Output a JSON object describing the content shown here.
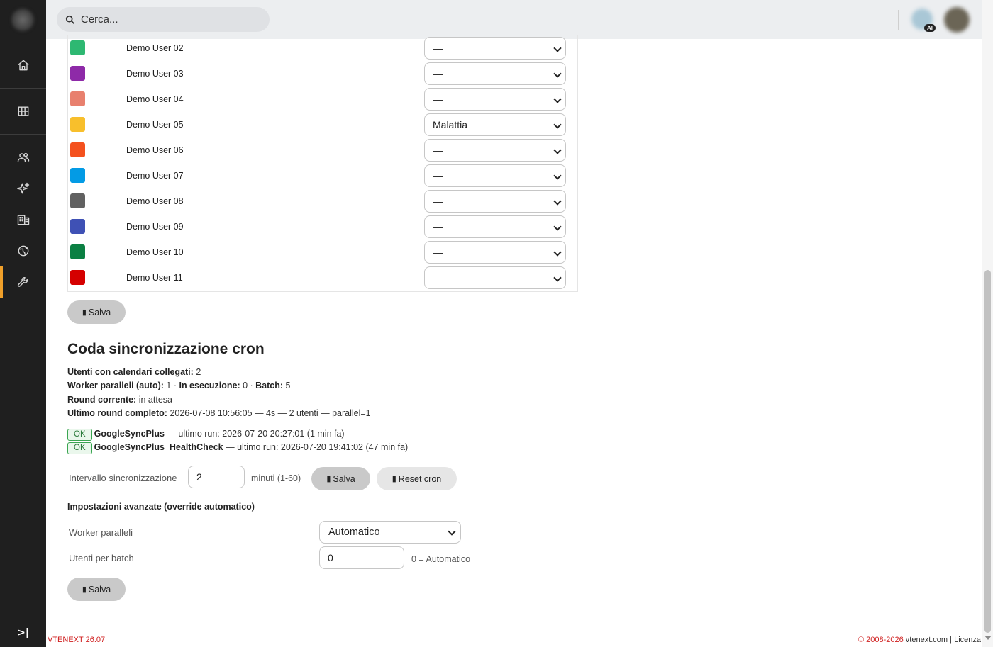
{
  "search": {
    "placeholder": "Cerca..."
  },
  "ai_badge": "AI",
  "users": [
    {
      "name": "Demo User 02",
      "color": "#2eb872",
      "absence": "—"
    },
    {
      "name": "Demo User 03",
      "color": "#8e2aa8",
      "absence": "—"
    },
    {
      "name": "Demo User 04",
      "color": "#e8806e",
      "absence": "—"
    },
    {
      "name": "Demo User 05",
      "color": "#f8bf2c",
      "absence": "Malattia"
    },
    {
      "name": "Demo User 06",
      "color": "#f4511e",
      "absence": "—"
    },
    {
      "name": "Demo User 07",
      "color": "#039be5",
      "absence": "—"
    },
    {
      "name": "Demo User 08",
      "color": "#616161",
      "absence": "—"
    },
    {
      "name": "Demo User 09",
      "color": "#3f51b5",
      "absence": "—"
    },
    {
      "name": "Demo User 10",
      "color": "#0b8043",
      "absence": "—"
    },
    {
      "name": "Demo User 11",
      "color": "#d50000",
      "absence": "—"
    }
  ],
  "save_label": "Salva",
  "save_icon": "▮",
  "cron": {
    "title": "Coda sincronizzazione cron",
    "linked_label": "Utenti con calendari collegati:",
    "linked_value": "2",
    "workers_label": "Worker paralleli (auto):",
    "workers_value": "1",
    "running_label": "In esecuzione:",
    "running_value": "0",
    "batch_label": "Batch:",
    "batch_value": "5",
    "round_label": "Round corrente:",
    "round_value": "in attesa",
    "last_label": "Ultimo round completo:",
    "last_value": "2026-07-08 10:56:05 — 4s — 2 utenti — parallel=1",
    "jobs": [
      {
        "status": "OK",
        "name": "GoogleSyncPlus",
        "detail": "— ultimo run: 2026-07-20 20:27:01 (1 min fa)"
      },
      {
        "status": "OK",
        "name": "GoogleSyncPlus_HealthCheck",
        "detail": "— ultimo run: 2026-07-20 19:41:02 (47 min fa)"
      }
    ],
    "interval_label": "Intervallo sincronizzazione",
    "interval_value": "2",
    "interval_hint": "minuti (1-60)",
    "reset_label": "Reset cron"
  },
  "advanced": {
    "title": "Impostazioni avanzate (override automatico)",
    "workers_label": "Worker paralleli",
    "workers_value": "Automatico",
    "batch_label": "Utenti per batch",
    "batch_value": "0",
    "batch_hint": "0 = Automatico"
  },
  "footer": {
    "version": "VTENEXT 26.07",
    "copyright": "© 2008-2026",
    "site": "vtenext.com",
    "separator": "|",
    "license": "Licenza"
  }
}
